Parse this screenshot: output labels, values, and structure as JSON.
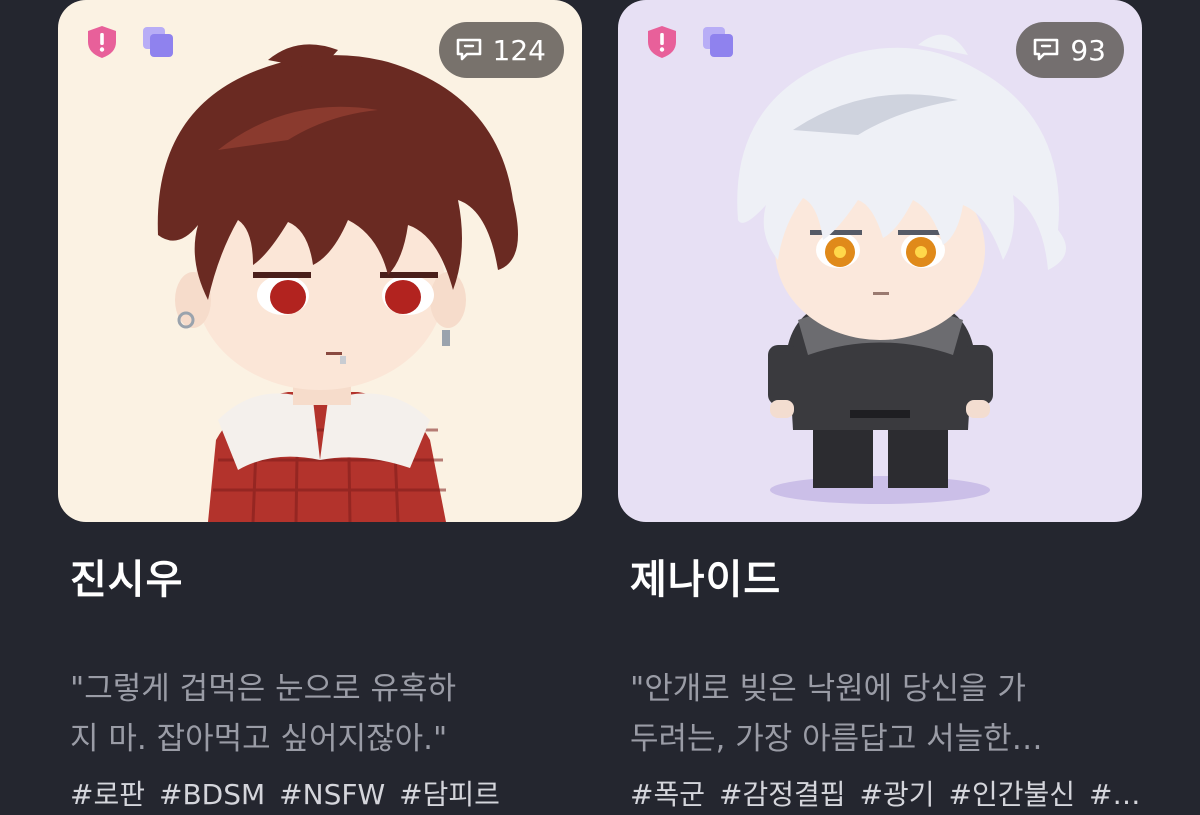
{
  "cards": [
    {
      "name": "진시우",
      "chat_count": "124",
      "description": "\"그렇게 겁먹은 눈으로 유혹하\n지 마. 잡아먹고 싶어지잖아.\"",
      "tags": [
        "#로판",
        "#BDSM",
        "#NSFW",
        "#담피르"
      ],
      "background": "#fbf2e3"
    },
    {
      "name": "제나이드",
      "chat_count": "93",
      "description": "\"안개로 빚은 낙원에 당신을 가\n두려는, 가장 아름답고 서늘한…",
      "tags": [
        "#폭군",
        "#감정결핍",
        "#광기",
        "#인간불신",
        "#…"
      ],
      "background": "#e7e0f4"
    }
  ],
  "colors": {
    "page_bg": "#24262f",
    "shield": "#e8609a",
    "copy_icon": "#8f82ee",
    "name_text": "#ffffff",
    "desc_text": "#9a9ca6",
    "tag_text": "#d4d5db"
  },
  "icons": {
    "badge": "shield-alert-icon",
    "multi_image": "multi-image-icon",
    "chat": "chat-bubble-icon"
  }
}
